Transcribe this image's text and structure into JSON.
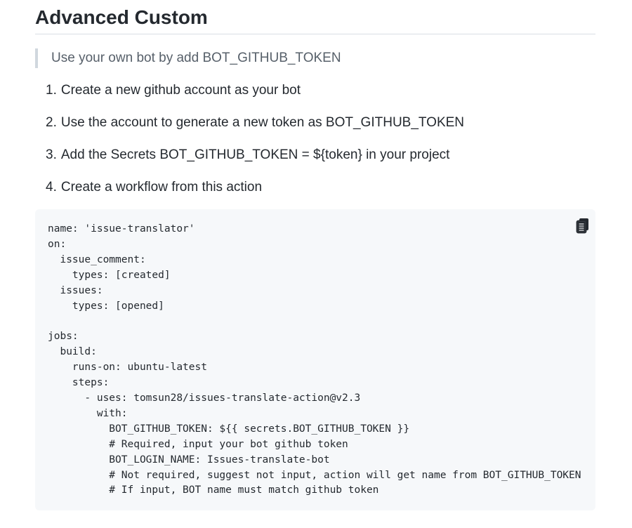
{
  "section": {
    "heading": "Advanced Custom",
    "quote": "Use your own bot by add BOT_GITHUB_TOKEN"
  },
  "steps": [
    {
      "num": "1.",
      "text": "Create a new github account as your bot"
    },
    {
      "num": "2.",
      "text": "Use the account to generate a new token as BOT_GITHUB_TOKEN"
    },
    {
      "num": "3.",
      "text": "Add the Secrets BOT_GITHUB_TOKEN = ${token} in your project"
    },
    {
      "num": "4.",
      "text": "Create a workflow from this action"
    }
  ],
  "code_block": {
    "copy_icon": "copy-clipboard-icon",
    "text": "name: 'issue-translator'\non:\n  issue_comment:\n    types: [created]\n  issues:\n    types: [opened]\n\njobs:\n  build:\n    runs-on: ubuntu-latest\n    steps:\n      - uses: tomsun28/issues-translate-action@v2.3\n        with:\n          BOT_GITHUB_TOKEN: ${{ secrets.BOT_GITHUB_TOKEN }}\n          # Required, input your bot github token\n          BOT_LOGIN_NAME: Issues-translate-bot\n          # Not required, suggest not input, action will get name from BOT_GITHUB_TOKEN\n          # If input, BOT name must match github token"
  }
}
